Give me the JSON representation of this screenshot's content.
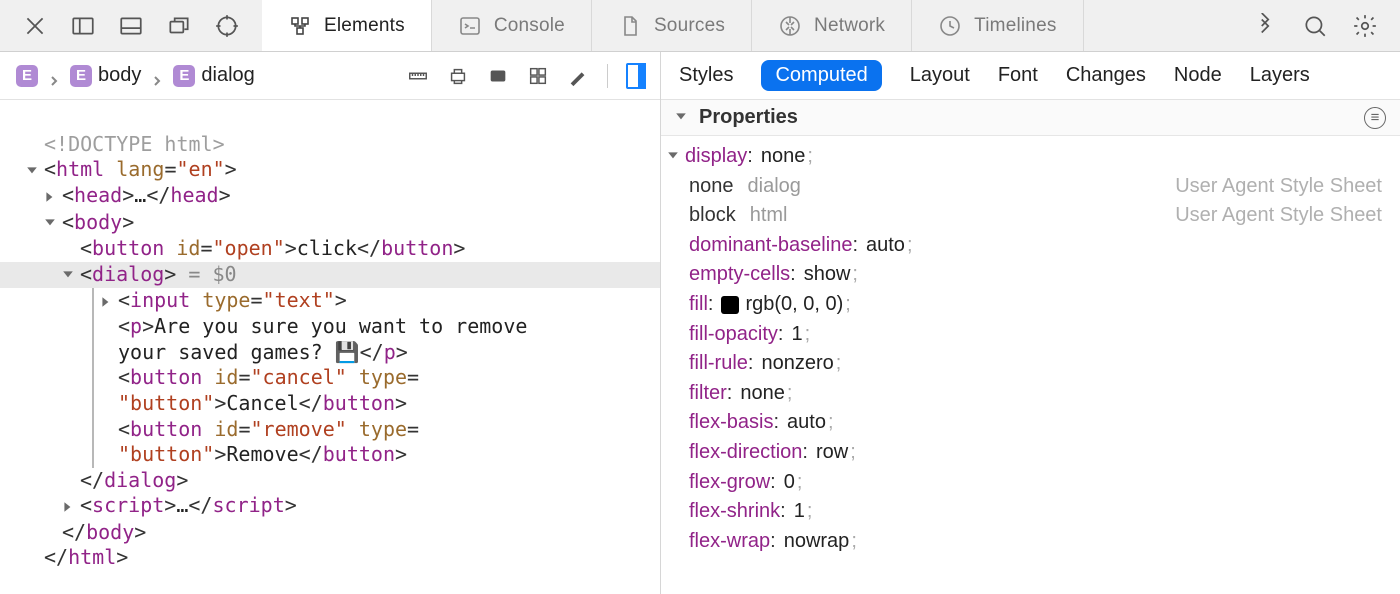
{
  "toolbar": {
    "close_icon": "close",
    "dock_v_icon": "dock-vertical",
    "dock_h_icon": "dock-horizontal",
    "detach_icon": "detach",
    "target_icon": "element-picker"
  },
  "tabs": [
    {
      "label": "Elements",
      "active": true
    },
    {
      "label": "Console",
      "active": false
    },
    {
      "label": "Sources",
      "active": false
    },
    {
      "label": "Network",
      "active": false
    },
    {
      "label": "Timelines",
      "active": false
    }
  ],
  "breadcrumbs": [
    {
      "badge": "E",
      "label": ""
    },
    {
      "badge": "E",
      "label": "body"
    },
    {
      "badge": "E",
      "label": "dialog"
    }
  ],
  "dom": {
    "doctype": "<!DOCTYPE html>",
    "html_open": {
      "tag": "html",
      "attr": "lang",
      "val": "en"
    },
    "head_line": {
      "tag": "head",
      "ellipsis": "…"
    },
    "body_open": "body",
    "button_open_tag": "button",
    "button_open_id": "open",
    "button_open_text": "click",
    "dialog_tag": "dialog",
    "dollar": "= $0",
    "input_tag": "input",
    "input_attr": "type",
    "input_val": "text",
    "p_text1": "Are you sure you want to remove",
    "p_text2": "your saved games? 💾",
    "btn_cancel_id": "cancel",
    "btn_cancel_type": "button",
    "btn_cancel_text": "Cancel",
    "btn_remove_id": "remove",
    "btn_remove_type": "button",
    "btn_remove_text": "Remove",
    "script_tag": "script"
  },
  "sidebar_tabs": [
    "Styles",
    "Computed",
    "Layout",
    "Font",
    "Changes",
    "Node",
    "Layers"
  ],
  "sidebar_active_index": 1,
  "properties_title": "Properties",
  "properties": [
    {
      "kind": "prop",
      "name": "display",
      "value": "none"
    },
    {
      "kind": "origin",
      "value": "none",
      "selector": "dialog",
      "origin": "User Agent Style Sheet"
    },
    {
      "kind": "origin",
      "value": "block",
      "selector": "html",
      "origin": "User Agent Style Sheet"
    },
    {
      "kind": "prop",
      "name": "dominant-baseline",
      "value": "auto"
    },
    {
      "kind": "prop",
      "name": "empty-cells",
      "value": "show"
    },
    {
      "kind": "propcolor",
      "name": "fill",
      "value": "rgb(0, 0, 0)"
    },
    {
      "kind": "prop",
      "name": "fill-opacity",
      "value": "1"
    },
    {
      "kind": "prop",
      "name": "fill-rule",
      "value": "nonzero"
    },
    {
      "kind": "prop",
      "name": "filter",
      "value": "none"
    },
    {
      "kind": "prop",
      "name": "flex-basis",
      "value": "auto"
    },
    {
      "kind": "prop",
      "name": "flex-direction",
      "value": "row"
    },
    {
      "kind": "prop",
      "name": "flex-grow",
      "value": "0"
    },
    {
      "kind": "prop",
      "name": "flex-shrink",
      "value": "1"
    },
    {
      "kind": "prop",
      "name": "flex-wrap",
      "value": "nowrap"
    }
  ]
}
